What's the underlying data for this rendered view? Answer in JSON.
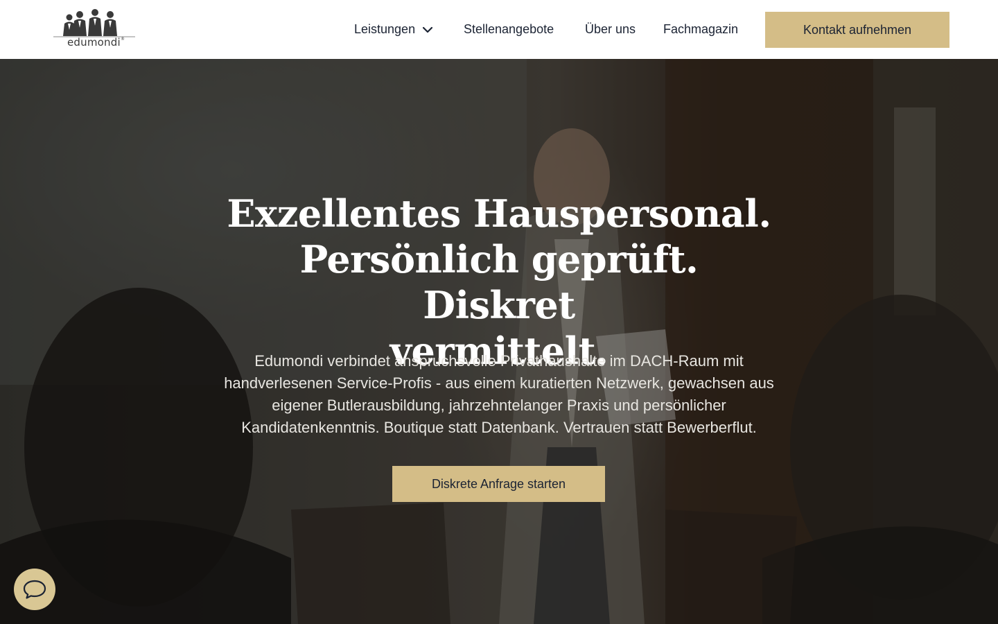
{
  "brand": {
    "name": "edumondi",
    "registered_mark": "®",
    "accent_color": "#d4bd87",
    "text_color": "#1b2333"
  },
  "nav": {
    "items": [
      {
        "label": "Leistungen",
        "has_dropdown": true
      },
      {
        "label": "Stellenangebote"
      },
      {
        "label": "Über uns"
      },
      {
        "label": "Fachmagazin"
      }
    ],
    "contact_label": "Kontakt aufnehmen"
  },
  "hero": {
    "title_lines": [
      "Exzellentes Hauspersonal.",
      "Persönlich geprüft. Diskret",
      "vermittelt."
    ],
    "text_lines": [
      "Edumondi verbindet anspruchsvolle Privathaushalte im DACH-Raum mit",
      "handverlesenen Service-Profis - aus einem kuratierten Netzwerk, gewachsen aus",
      "eigener Butlerausbildung, jahrzehntelanger Praxis und persönlicher",
      "Kandidatenkenntnis. Boutique statt Datenbank. Vertrauen statt Bewerberflut."
    ],
    "cta_label": "Diskrete Anfrage starten"
  },
  "chat": {
    "icon": "chat-bubble-icon"
  }
}
